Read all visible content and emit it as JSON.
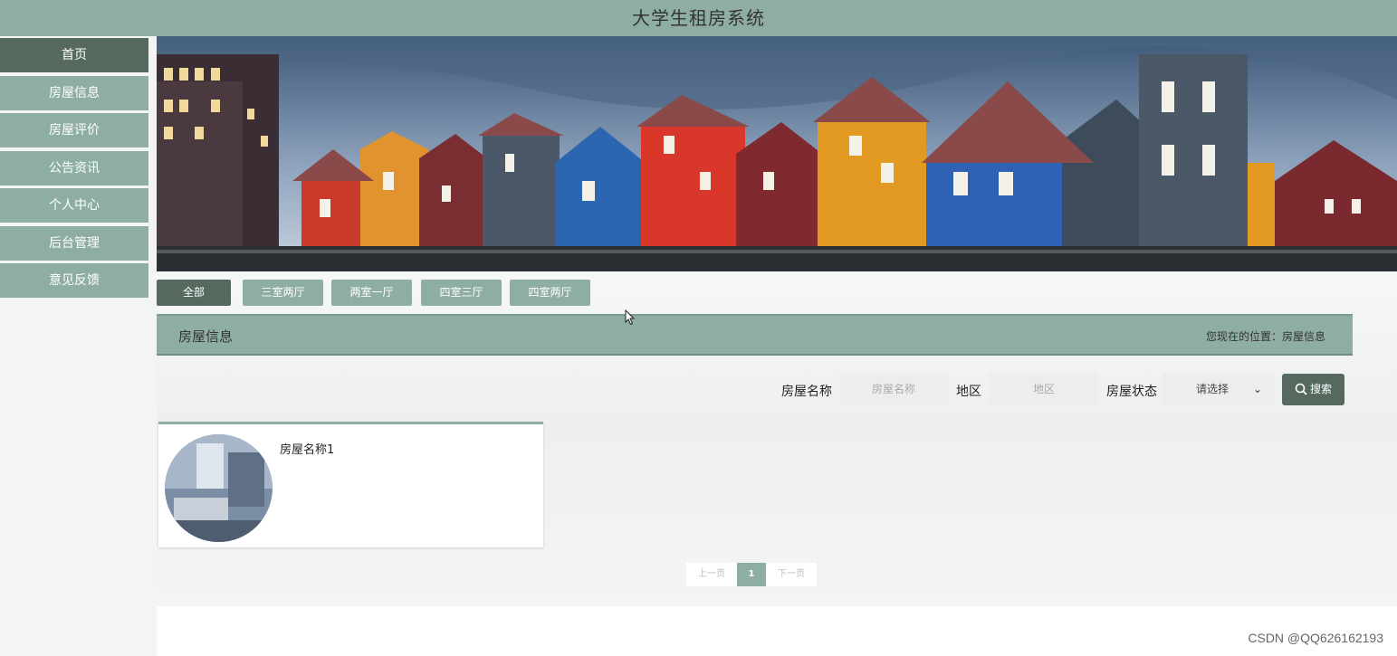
{
  "header": {
    "title": "大学生租房系统"
  },
  "sidebar": {
    "items": [
      {
        "label": "首页",
        "active": true
      },
      {
        "label": "房屋信息",
        "active": false
      },
      {
        "label": "房屋评价",
        "active": false
      },
      {
        "label": "公告资讯",
        "active": false
      },
      {
        "label": "个人中心",
        "active": false
      },
      {
        "label": "后台管理",
        "active": false
      },
      {
        "label": "意见反馈",
        "active": false
      }
    ]
  },
  "filters": {
    "tabs": [
      {
        "label": "全部",
        "active": true
      },
      {
        "label": "三室两厅",
        "active": false
      },
      {
        "label": "两室一厅",
        "active": false
      },
      {
        "label": "四室三厅",
        "active": false
      },
      {
        "label": "四室两厅",
        "active": false
      }
    ]
  },
  "section": {
    "title": "房屋信息",
    "breadcrumb": "您现在的位置：房屋信息"
  },
  "search": {
    "name_label": "房屋名称",
    "name_placeholder": "房屋名称",
    "region_label": "地区",
    "region_placeholder": "地区",
    "status_label": "房屋状态",
    "status_selected": "请选择",
    "button_label": "搜索",
    "button_icon": "search-icon"
  },
  "listings": [
    {
      "name": "房屋名称1"
    }
  ],
  "pagination": {
    "prev_label": "上一页",
    "current_page": "1",
    "next_label": "下一页"
  },
  "watermark": "CSDN @QQ626162193",
  "colors": {
    "primary": "#8eaea4",
    "dark": "#55695f",
    "background": "#f5f6f6"
  }
}
